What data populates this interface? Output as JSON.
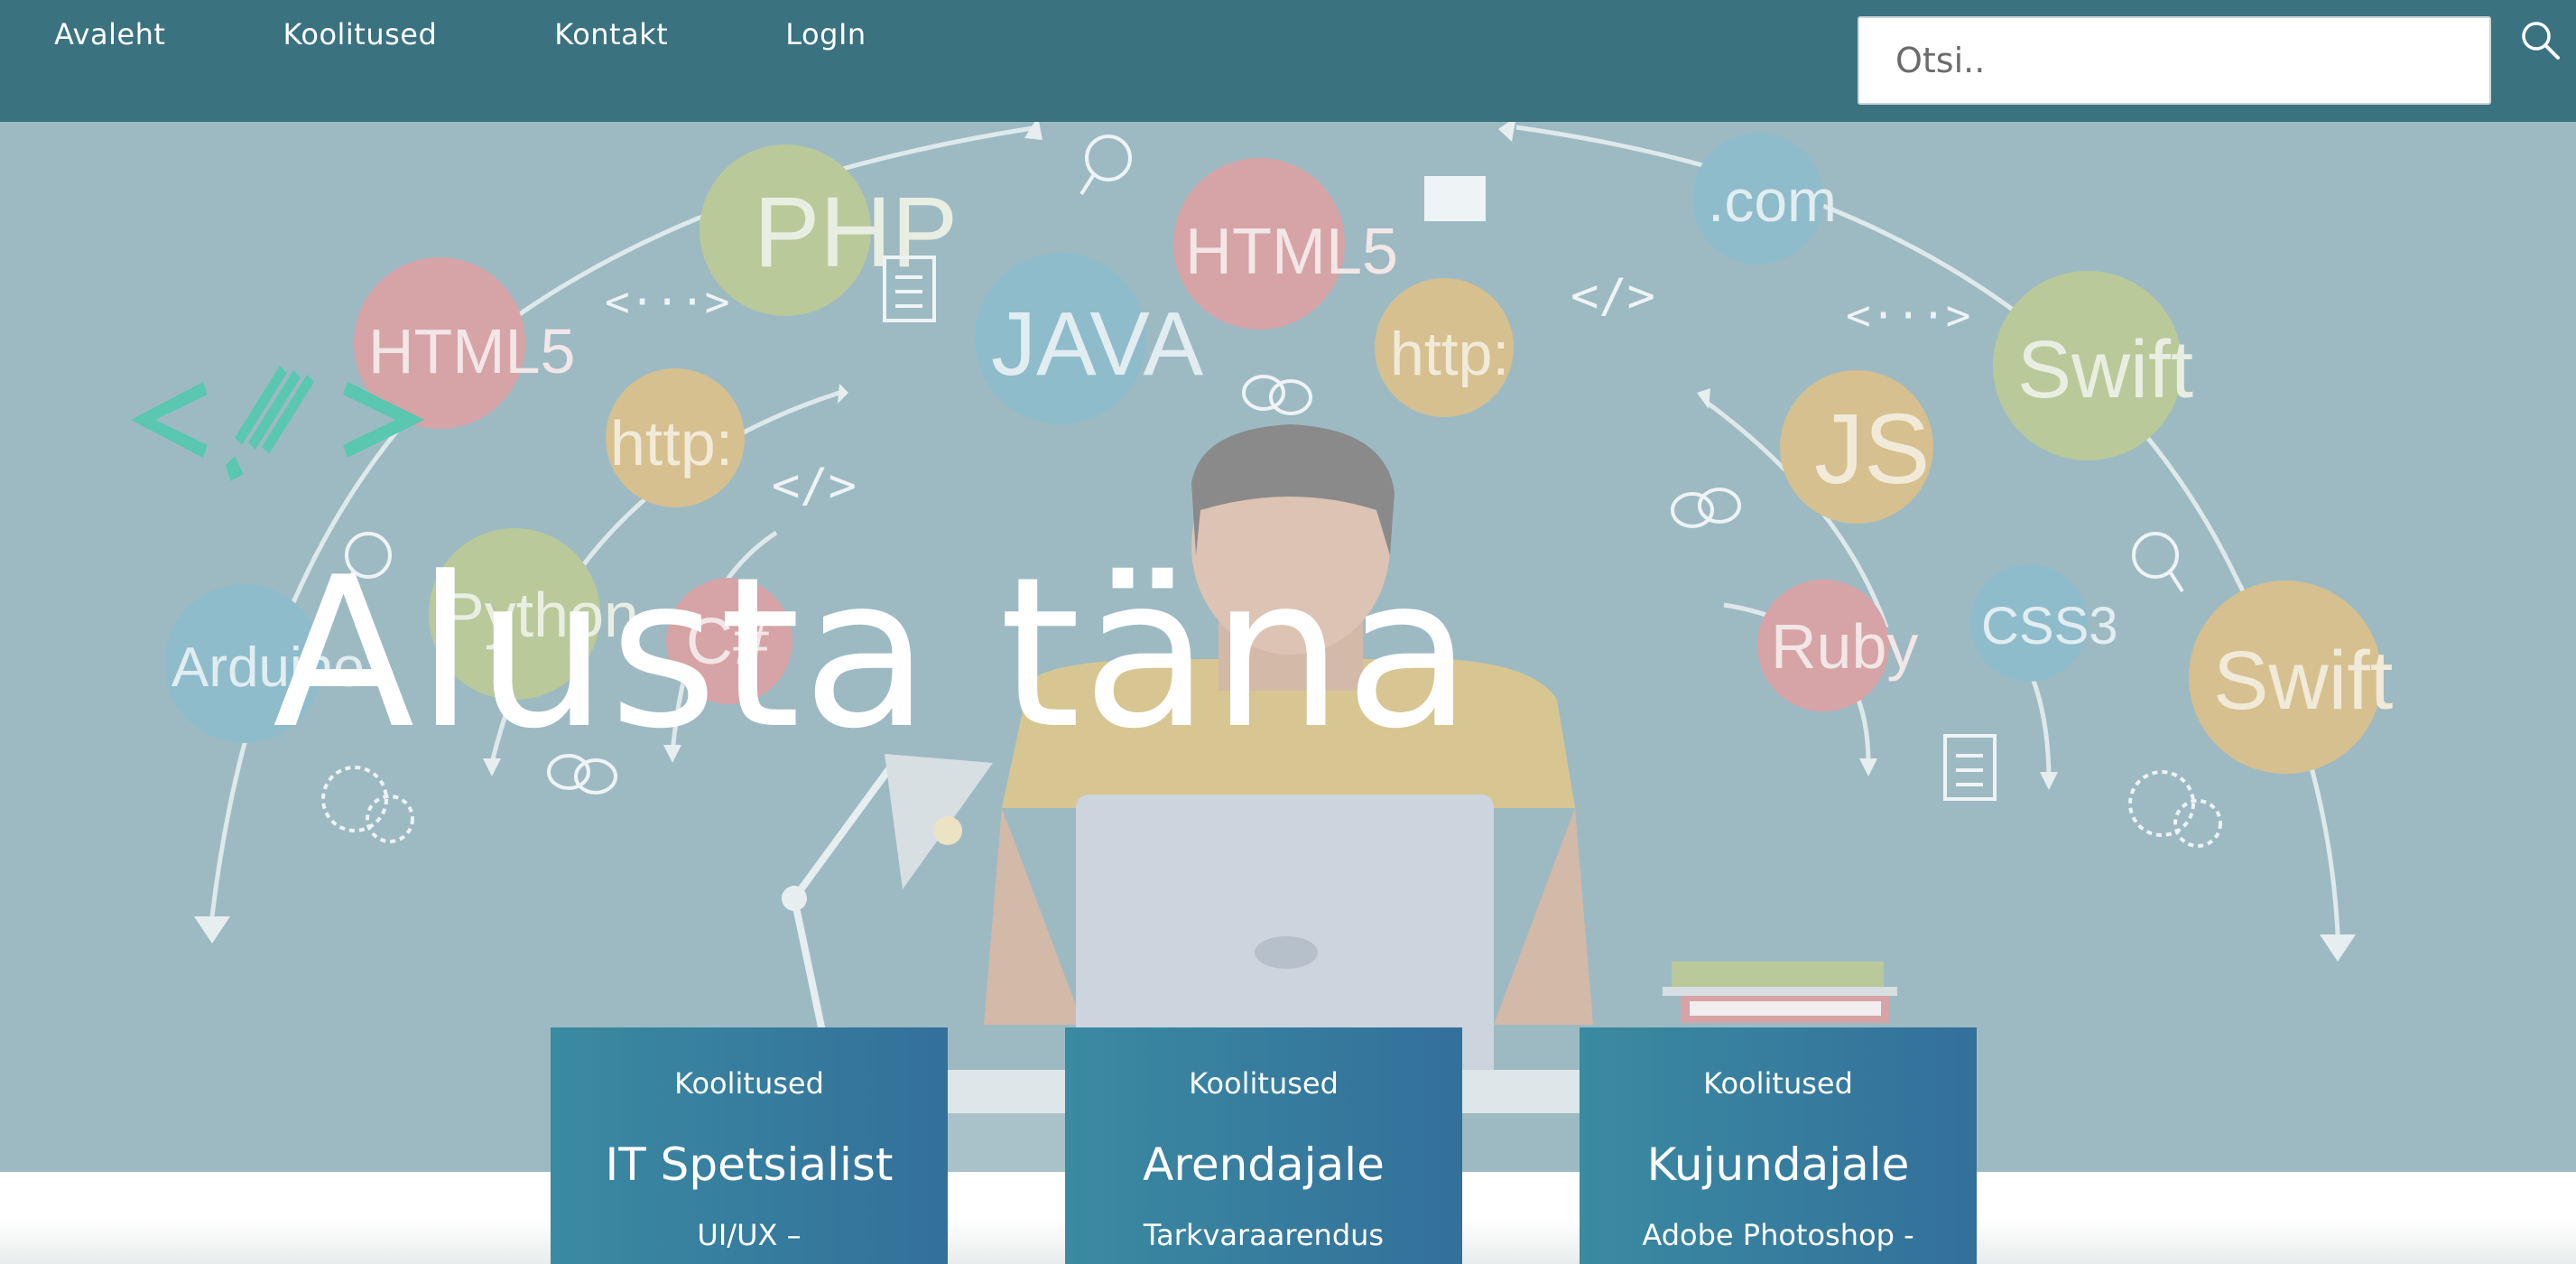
{
  "nav": {
    "links": [
      "Avaleht",
      "Koolitused",
      "Kontakt",
      "LogIn"
    ],
    "search_placeholder": "Otsi.."
  },
  "hero": {
    "title": "Alusta täna",
    "bubbles": [
      {
        "label": "PHP",
        "color": "#b9c99a"
      },
      {
        "label": "HTML5",
        "color": "#d6a3a6"
      },
      {
        "label": "HTML5",
        "color": "#d6a3a6"
      },
      {
        "label": "JAVA",
        "color": "#8fbccb"
      },
      {
        "label": "http:",
        "color": "#d6c08f"
      },
      {
        "label": "http:",
        "color": "#d6c08f"
      },
      {
        "label": ".com",
        "color": "#8fbccb"
      },
      {
        "label": "Swift",
        "color": "#b9c99a"
      },
      {
        "label": "JS",
        "color": "#d6c08f"
      },
      {
        "label": "Python",
        "color": "#b9c99a"
      },
      {
        "label": "Arduino",
        "color": "#8fbccb"
      },
      {
        "label": "C#",
        "color": "#d6a3a6"
      },
      {
        "label": "Ruby",
        "color": "#d6a3a6"
      },
      {
        "label": "CSS3",
        "color": "#8fbccb"
      },
      {
        "label": "Swift",
        "color": "#d6c08f"
      }
    ],
    "code_symbols": [
      "<···>",
      "</>",
      "</>",
      "<···>",
      "</>"
    ]
  },
  "cards": [
    {
      "kicker": "Koolitused",
      "title": "IT Spetsialist",
      "desc": "UI/UX –"
    },
    {
      "kicker": "Koolitused",
      "title": "Arendajale",
      "desc": "Tarkvaraarendus"
    },
    {
      "kicker": "Koolitused",
      "title": "Kujundajale",
      "desc": "Adobe Photoshop -"
    }
  ],
  "colors": {
    "navbar": "#3a7280",
    "hero_bg": "#9dbac3",
    "card_gradient_start": "#3a8aa2",
    "card_gradient_end": "#33709a",
    "logo_accent": "#5ac7b0"
  }
}
